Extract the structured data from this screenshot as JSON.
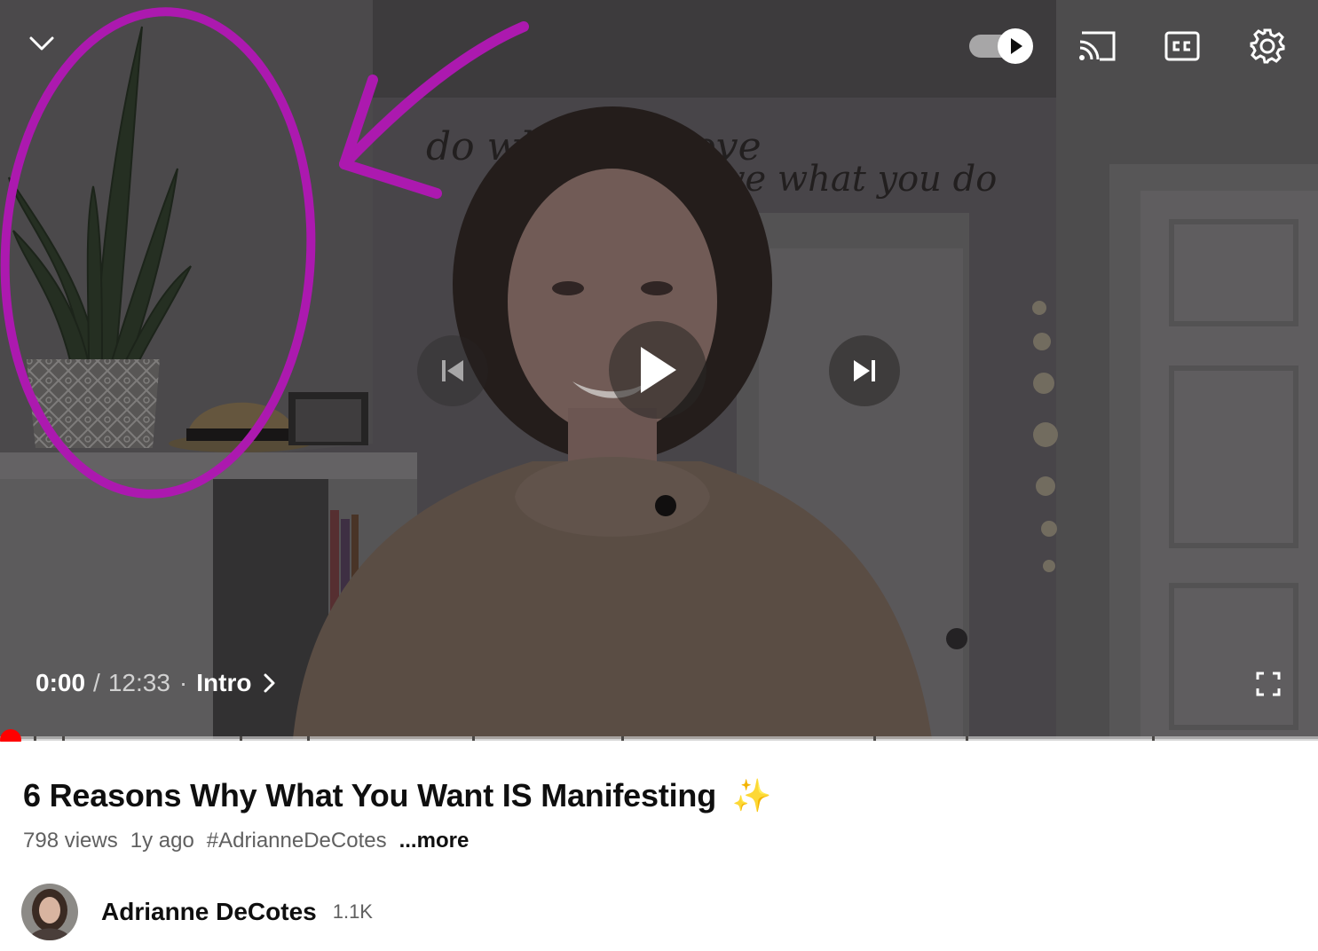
{
  "player": {
    "time_current": "0:00",
    "time_total": "12:33",
    "separator": "/",
    "chapter_sep": "·",
    "chapter": "Intro",
    "progress": 0.0,
    "autoplay_on": true,
    "wall_text_1": "do what you love",
    "wall_text_2": "love what you do"
  },
  "video": {
    "title": "6 Reasons Why What You Want IS Manifesting",
    "title_emoji": "✨",
    "views": "798 views",
    "age": "1y ago",
    "hashtag": "#AdrianneDeCotes",
    "more": "...more"
  },
  "channel": {
    "name": "Adrianne DeCotes",
    "subscribers": "1.1K"
  },
  "icons": {
    "collapse": "chevron-down-icon",
    "autoplay": "autoplay-toggle-icon",
    "cast": "cast-icon",
    "captions": "captions-icon",
    "settings": "gear-icon",
    "previous": "skip-previous-icon",
    "play": "play-icon",
    "next": "skip-next-icon",
    "fullscreen": "fullscreen-icon"
  },
  "colors": {
    "progress_red": "#ff0000",
    "annotation_magenta": "#d21fd6",
    "text_primary": "#0f0f0f",
    "text_secondary": "#606060"
  }
}
